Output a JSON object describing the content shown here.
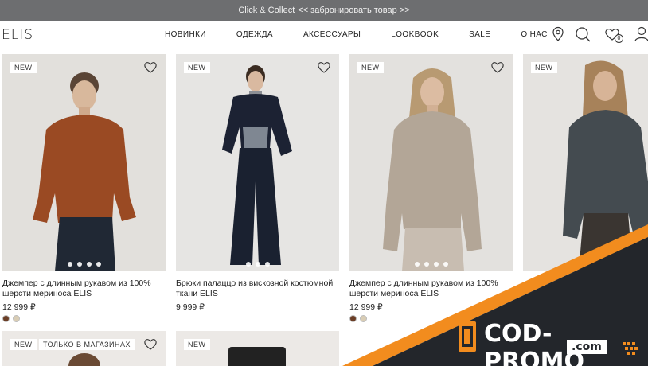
{
  "promo_bar": {
    "text": "Click & Collect",
    "link": "<< забронировать товар >>"
  },
  "header": {
    "logo": "ELIS",
    "nav": [
      "НОВИНКИ",
      "ОДЕЖДА",
      "АКСЕССУАРЫ",
      "LOOKBOOK",
      "SALE",
      "О НАС"
    ],
    "icons": [
      "location-pin-icon",
      "search-icon",
      "heart-icon",
      "user-icon"
    ],
    "wishlist_count": "0"
  },
  "products": [
    {
      "tag": "NEW",
      "title": "Джемпер с длинным рукавом из 100% шерсти мериноса ELIS",
      "price": "12 999 ₽",
      "swatches": [
        "#6b3e26",
        "#d9cdb5"
      ],
      "colour": "rust"
    },
    {
      "tag": "NEW",
      "title": "Брюки палаццо из вискозной костюмной ткани ELIS",
      "price": "9 999 ₽",
      "swatches": [],
      "colour": "navy"
    },
    {
      "tag": "NEW",
      "title": "Джемпер с длинным рукавом из 100% шерсти мериноса ELIS",
      "price": "12 999 ₽",
      "swatches": [
        "#6b3e26",
        "#d9cdb5"
      ],
      "colour": "beige"
    },
    {
      "tag": "NEW",
      "title": "",
      "price": "",
      "swatches": [],
      "colour": "grey"
    }
  ],
  "row2": [
    {
      "tag": "NEW",
      "tag2": "ТОЛЬКО В МАГАЗИНАХ"
    },
    {
      "tag": "NEW"
    }
  ],
  "watermark": {
    "brand": "COD-PROMO",
    "domain": ".com"
  },
  "colors": {
    "promo_bg": "#6d6e70",
    "ribbon_orange": "#f28c1e",
    "ribbon_dark": "#23262b"
  }
}
